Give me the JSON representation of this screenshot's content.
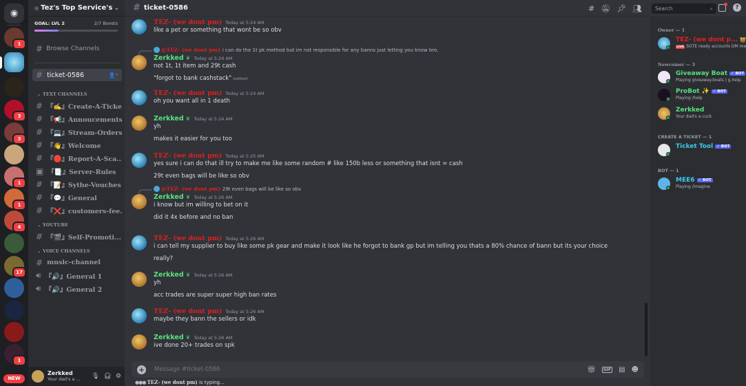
{
  "server": {
    "name": "Tez's Top Service's",
    "goal_label": "GOAL: LVL 2",
    "boosts": "2/7 Boosts",
    "boost_progress": 0.2857
  },
  "browse_label": "Browse Channels",
  "active_channel": "ticket-0586",
  "categories": {
    "text": "TEXT CHANNELS",
    "youtube": "YOUTUBE",
    "voice": "VOICE CHANNELS"
  },
  "text_channels": [
    "『✍️』Create-A-Ticket",
    "『📢』Annoucements",
    "『💻』Stream-Orders",
    "『👋』Welcome",
    "『🛑』Report-A-Sca...",
    "『📑』Server-Rules",
    "『📝』Sythe-Vouches",
    "『💬』General",
    "『❌』customers-fee..."
  ],
  "youtube_channels": [
    "『🎬』Self-Promoti..."
  ],
  "voice_channels": [
    "music-channel",
    "『🔊』General 1",
    "『🔊』General 2"
  ],
  "user": {
    "name": "Zerkked",
    "status": "Your dad's a ..."
  },
  "guild_badges": [
    "1",
    "3",
    "3",
    "1",
    "1",
    "4",
    "17",
    "1"
  ],
  "new_label": "NEW",
  "messages": [
    {
      "author": "TEZ- (we dont pm)",
      "time": "Today at 5:24 AM",
      "lines": [
        "like a pet or something that wont be so obv"
      ]
    },
    {
      "reply_author": "@TEZ- (we dont pm)",
      "reply_text": "i can do the 1t pk method but im not responsible for any banns just letting you know bro.",
      "author": "Zerkked",
      "time": "Today at 5:24 AM",
      "lines": [
        "not 1t, 1t item and 29t cash",
        "\"forgot to bank cashstack\""
      ],
      "edited": "(edited)"
    },
    {
      "author": "TEZ- (we dont pm)",
      "time": "Today at 5:24 AM",
      "lines": [
        "oh you want all in 1 death"
      ]
    },
    {
      "author": "Zerkked",
      "time": "Today at 5:24 AM",
      "lines": [
        "yh",
        "makes it easier for you too"
      ]
    },
    {
      "author": "TEZ- (we dont pm)",
      "time": "Today at 5:25 AM",
      "lines": [
        "yes sure i can do that ill try to make me like some random # like 150b less or something that isnt = cash",
        "29t even bags will be like  so obv"
      ]
    },
    {
      "reply_author": "@TEZ- (we dont pm)",
      "reply_text": "29t even bags will be like so obv",
      "author": "Zerkked",
      "time": "Today at 5:26 AM",
      "lines": [
        "i know but im willing to bet on it",
        "did it 4x before and no ban"
      ]
    },
    {
      "author": "TEZ- (we dont pm)",
      "time": "Today at 5:26 AM",
      "lines": [
        "i can tell my supplier to buy like some pk gear and make it look like he forgot to bank gp but im telling you thats a 80% chance of bann but its your choice",
        "really?"
      ]
    },
    {
      "author": "Zerkked",
      "time": "Today at 5:26 AM",
      "lines": [
        "yh",
        "acc trades are super super high ban rates"
      ]
    },
    {
      "author": "TEZ- (we dont pm)",
      "time": "Today at 5:26 AM",
      "lines": [
        "maybe they bann the sellers or idk"
      ]
    },
    {
      "author": "Zerkked",
      "time": "Today at 5:26 AM",
      "lines": [
        "ive done 20+ trades on spk"
      ]
    }
  ],
  "composer_placeholder": "Message #ticket-0586",
  "typing": {
    "name": "TEZ- (we dont pm)",
    "suffix": " is typing..."
  },
  "search_placeholder": "Search",
  "member_groups": [
    {
      "title": "Owner — 1",
      "members": [
        {
          "name": "TEZ- (we dont p...",
          "status": "SOTE ready accounts DM me.",
          "color": "#e02020",
          "live": "LIVE"
        }
      ]
    },
    {
      "title": "Newcomer — 3",
      "members": [
        {
          "name": "Giveaway Boat",
          "bot": "✓ BOT",
          "status": "Playing giveaway.boats | g.help",
          "color": "#58e07d"
        },
        {
          "name": "ProBot ✨",
          "bot": "✓ BOT",
          "status": "Playing /help",
          "color": "#58e07d"
        },
        {
          "name": "Zerkked",
          "status": "Your dad's a cuck",
          "color": "#58e07d"
        }
      ]
    },
    {
      "title": "CREATE A TICKET — 1",
      "members": [
        {
          "name": "Ticket Tool",
          "bot": "✓ BOT",
          "status": "",
          "color": "#3ec7f0"
        }
      ]
    },
    {
      "title": "BOT — 1",
      "members": [
        {
          "name": "MEE6",
          "bot": "✓ BOT",
          "status": "Playing /imagine",
          "color": "#3ec7f0"
        }
      ]
    }
  ]
}
